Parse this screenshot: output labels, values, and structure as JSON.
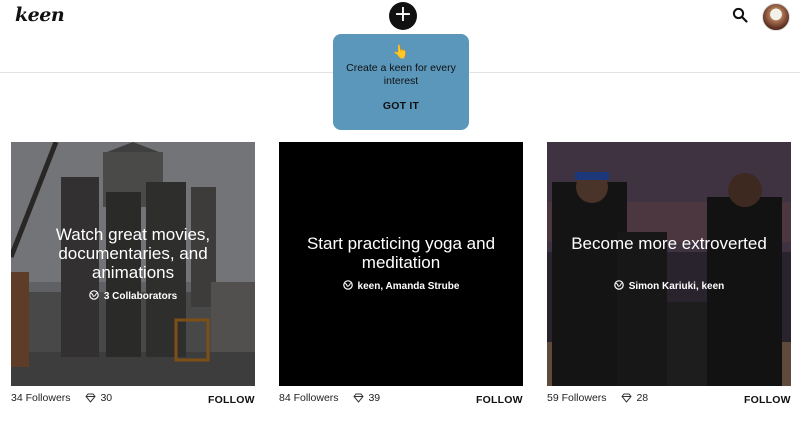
{
  "header": {
    "logo_text": "keen",
    "create_symbol": "+",
    "search_icon": "search-icon",
    "avatar_icon": "user-avatar"
  },
  "tooltip": {
    "emoji": "👆",
    "message": "Create a keen for every interest",
    "button": "GOT IT",
    "color": "#5b96bb"
  },
  "cards": [
    {
      "title": "Watch great movies, documentaries, and animations",
      "contributors": "3 Collaborators",
      "followers": "34 Followers",
      "gems": "30",
      "follow_label": "FOLLOW",
      "background": "photo-construction"
    },
    {
      "title": "Start practicing yoga and meditation",
      "contributors": "keen, Amanda Strube",
      "followers": "84 Followers",
      "gems": "39",
      "follow_label": "FOLLOW",
      "background": "solid-black"
    },
    {
      "title": "Become more extroverted",
      "contributors": "Simon Kariuki, keen",
      "followers": "59 Followers",
      "gems": "28",
      "follow_label": "FOLLOW",
      "background": "photo-basketball"
    }
  ]
}
